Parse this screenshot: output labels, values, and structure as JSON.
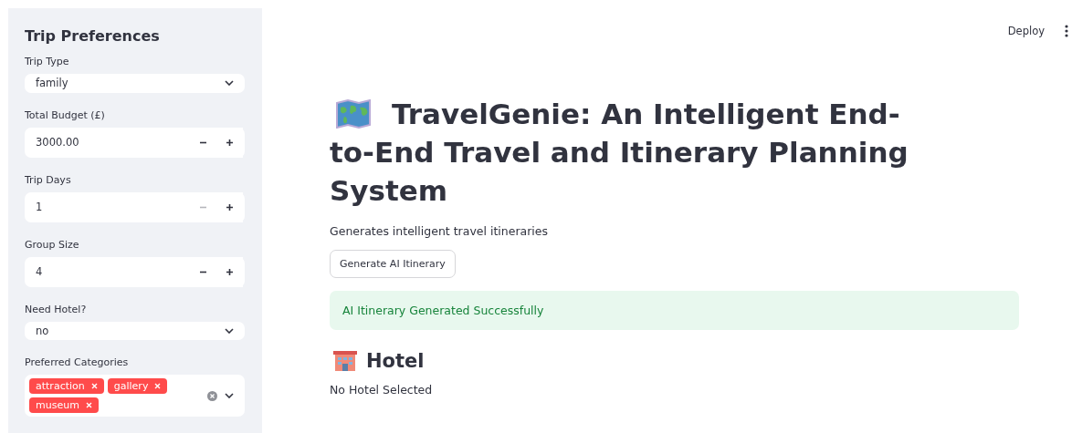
{
  "sidebar": {
    "title": "Trip Preferences",
    "fields": [
      {
        "kind": "select",
        "label": "Trip Type",
        "value": "family"
      },
      {
        "kind": "number",
        "label": "Total Budget (£)",
        "value": "3000.00",
        "minus_disabled": false
      },
      {
        "kind": "number",
        "label": "Trip Days",
        "value": "1",
        "minus_disabled": true
      },
      {
        "kind": "number",
        "label": "Group Size",
        "value": "4",
        "minus_disabled": false
      },
      {
        "kind": "select",
        "label": "Need Hotel?",
        "value": "no"
      },
      {
        "kind": "multiselect",
        "label": "Preferred Categories",
        "tags": [
          "attraction",
          "gallery",
          "museum"
        ]
      }
    ]
  },
  "header": {
    "deploy": "Deploy"
  },
  "main": {
    "title_lines": [
      "TravelGenie: An Intelligent End-",
      "to-End Travel and Itinerary Planning",
      "System"
    ],
    "caption": "Generates intelligent travel itineraries",
    "button": "Generate AI Itinerary",
    "alert": {
      "kind": "success",
      "text": "AI Itinerary Generated Successfully"
    },
    "hotel_heading": "Hotel",
    "hotel_text": "No Hotel Selected"
  }
}
